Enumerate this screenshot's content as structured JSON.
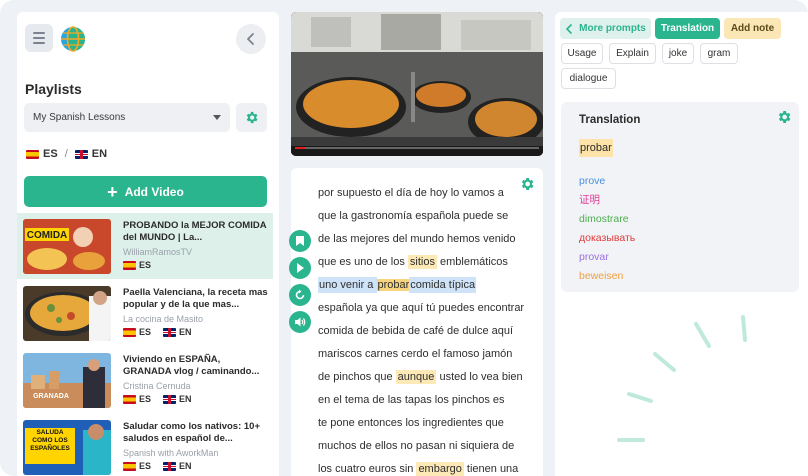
{
  "left_panel": {
    "playlists_title": "Playlists",
    "playlist_selected": "My Spanish Lessons",
    "source_lang": "ES",
    "target_lang": "EN",
    "lang_separator": "/",
    "add_video_label": "Add Video"
  },
  "videos": [
    {
      "title": "PROBANDO la MEJOR COMIDA del MUNDO | La...",
      "channel": "WilliamRamosTV",
      "langs": [
        "ES"
      ],
      "active": true,
      "thumb_text": "COMIDA"
    },
    {
      "title": "Paella Valenciana, la receta mas popular y de la que mas...",
      "channel": "La cocina de Masito",
      "langs": [
        "ES",
        "EN"
      ],
      "active": false,
      "thumb_text": ""
    },
    {
      "title": "Viviendo en ESPAÑA, GRANADA vlog / caminando...",
      "channel": "Cristina Cernuda",
      "langs": [
        "ES",
        "EN"
      ],
      "active": false,
      "thumb_text": "GRANADA"
    },
    {
      "title": "Saludar como los nativos: 10+ saludos en español de...",
      "channel": "Spanish with AworkMan",
      "langs": [
        "ES",
        "EN"
      ],
      "active": false,
      "thumb_text": "SALUDA COMO LOS ESPAÑOLES"
    }
  ],
  "transcript": {
    "lines": [
      [
        {
          "t": "por supuesto el día de hoy lo vamos a"
        }
      ],
      [
        {
          "t": "que la gastronomía española puede se"
        }
      ],
      [
        {
          "t": "de las mejores del mundo hemos venido"
        }
      ],
      [
        {
          "t": "que es uno de los "
        },
        {
          "t": "sitios",
          "hl": "y"
        },
        {
          "t": " emblemáticos"
        }
      ],
      [
        {
          "t": "uno venir a ",
          "hl": "b"
        },
        {
          "t": "probar",
          "hl": "o"
        },
        {
          "t": "comida típica",
          "hl": "b"
        }
      ],
      [
        {
          "t": "española ya que aquí tú puedes encontrar"
        }
      ],
      [
        {
          "t": "comida de bebida de café de dulce aquí"
        }
      ],
      [
        {
          "t": "mariscos carnes cerdo el famoso jamón"
        }
      ],
      [
        {
          "t": "de pinchos que "
        },
        {
          "t": "aunque",
          "hl": "y"
        },
        {
          "t": " usted lo vea bien"
        }
      ],
      [
        {
          "t": "en el tema de las tapas los pinchos es"
        }
      ],
      [
        {
          "t": "te pone entonces los ingredientes que"
        }
      ],
      [
        {
          "t": "muchos de ellos no pasan ni siquiera de"
        }
      ],
      [
        {
          "t": "los cuatro euros sin "
        },
        {
          "t": "embargo",
          "hl": "y"
        },
        {
          "t": " tienen una"
        }
      ]
    ]
  },
  "right_panel": {
    "more_prompts_label": "More prompts",
    "translation_tab_label": "Translation",
    "add_note_label": "Add note",
    "prompt_chips": [
      "Usage",
      "Explain",
      "joke",
      "gram",
      "dialogue"
    ],
    "card_title": "Translation",
    "selected_word": "probar",
    "translations": [
      {
        "text": "prove",
        "color": "#4a8fe0"
      },
      {
        "text": "证明",
        "color": "#e0409a"
      },
      {
        "text": "dimostrare",
        "color": "#4cae4c"
      },
      {
        "text": "доказывать",
        "color": "#e03a3a"
      },
      {
        "text": "provar",
        "color": "#9b6fe0"
      },
      {
        "text": "beweisen",
        "color": "#f0a040"
      }
    ]
  },
  "colors": {
    "accent": "#2bb58f",
    "active_row": "#ddf1ea",
    "highlight_yellow": "#fde9b6",
    "highlight_blue": "#cfe3f8"
  }
}
